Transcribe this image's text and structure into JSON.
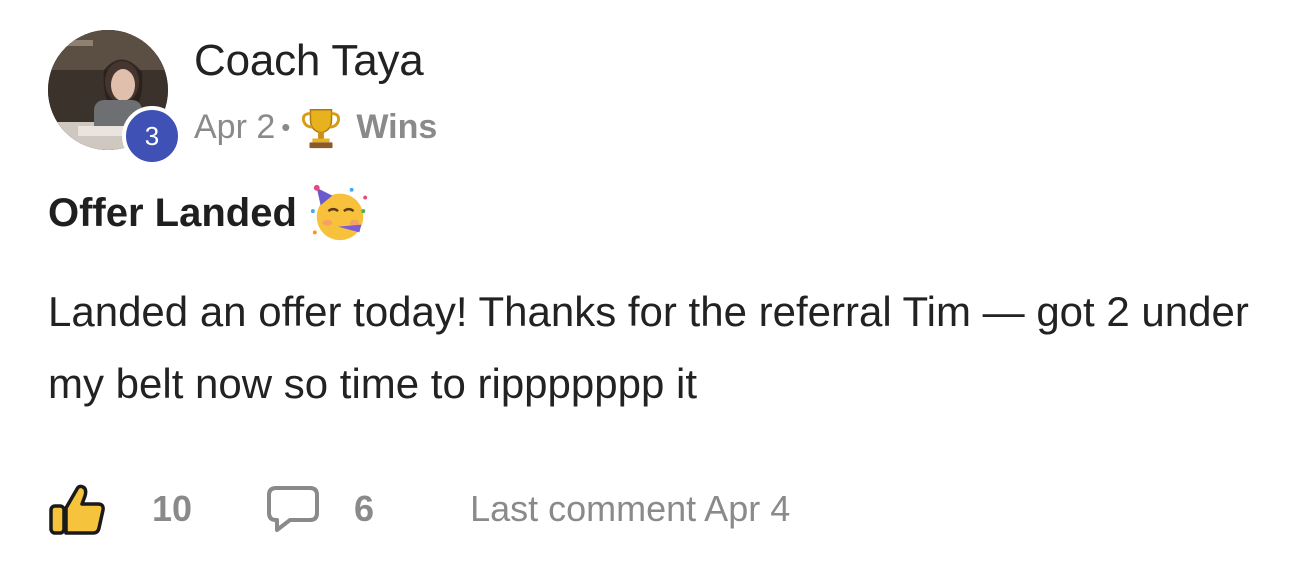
{
  "post": {
    "author": "Coach Taya",
    "level": "3",
    "date": "Apr 2",
    "separator": "•",
    "category": "Wins",
    "category_icon": "trophy-icon",
    "title": "Offer Landed",
    "title_emoji": "partying-face-icon",
    "body": "Landed an offer today! Thanks for the referral Tim — got 2 under my belt now so time to rippppppp it"
  },
  "footer": {
    "like_icon": "thumbs-up-icon",
    "likes": "10",
    "comment_icon": "comment-bubble-icon",
    "comments": "6",
    "last_comment": "Last comment Apr 4"
  },
  "colors": {
    "badge": "#3f51b5",
    "muted_text": "#8a8a8a",
    "like_fill": "#f6c43c",
    "text": "#222222"
  }
}
